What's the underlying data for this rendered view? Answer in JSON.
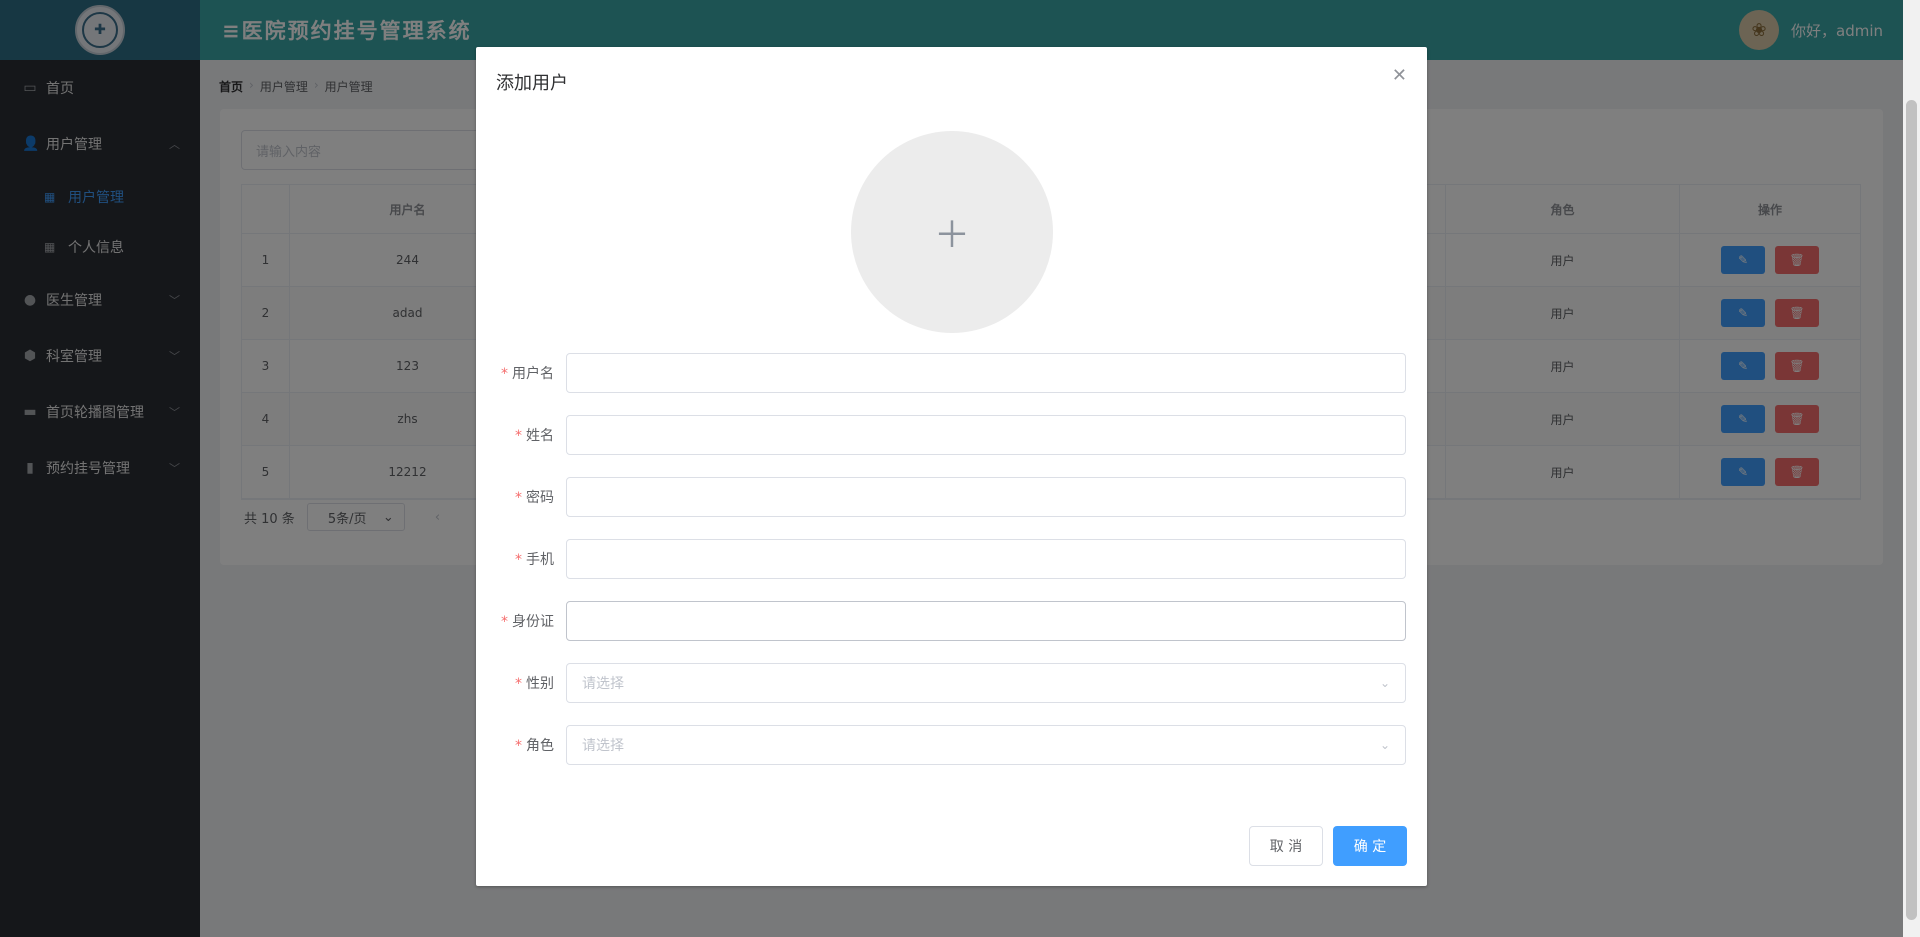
{
  "header": {
    "title": "≡医院预约挂号管理系统",
    "greeting": "你好，admin",
    "avatar_icon": "avatar-icon"
  },
  "sidebar": {
    "items": [
      {
        "label": "首页",
        "icon": "monitor-icon"
      },
      {
        "label": "用户管理",
        "icon": "users-icon",
        "expanded": true,
        "children": [
          {
            "label": "用户管理",
            "icon": "grid-icon",
            "active": true
          },
          {
            "label": "个人信息",
            "icon": "grid-icon"
          }
        ]
      },
      {
        "label": "医生管理",
        "icon": "user-icon"
      },
      {
        "label": "科室管理",
        "icon": "box-icon"
      },
      {
        "label": "首页轮播图管理",
        "icon": "picture-icon"
      },
      {
        "label": "预约挂号管理",
        "icon": "clipboard-icon"
      }
    ]
  },
  "breadcrumb": [
    "首页",
    "用户管理",
    "用户管理"
  ],
  "search": {
    "placeholder": "请输入内容"
  },
  "table": {
    "headers": {
      "username": "用户名",
      "role": "角色",
      "ops": "操作"
    },
    "rows": [
      {
        "idx": "1",
        "username": "244",
        "role": "用户"
      },
      {
        "idx": "2",
        "username": "adad",
        "role": "用户"
      },
      {
        "idx": "3",
        "username": "123",
        "role": "用户"
      },
      {
        "idx": "4",
        "username": "zhs",
        "role": "用户"
      },
      {
        "idx": "5",
        "username": "12212",
        "role": "用户"
      }
    ]
  },
  "pager": {
    "total": "共 10 条",
    "page_size": "5条/页"
  },
  "dialog": {
    "title": "添加用户",
    "fields": [
      {
        "label": "用户名",
        "value": ""
      },
      {
        "label": "姓名",
        "value": ""
      },
      {
        "label": "密码",
        "value": ""
      },
      {
        "label": "手机",
        "value": ""
      },
      {
        "label": "身份证",
        "value": ""
      },
      {
        "label": "性别",
        "placeholder": "请选择"
      },
      {
        "label": "角色",
        "placeholder": "请选择"
      }
    ],
    "cancel_label": "取 消",
    "confirm_label": "确 定"
  },
  "colors": {
    "header": "#3ba6a7",
    "sidebar": "#2b2e35",
    "primary": "#409eff",
    "danger": "#f56c6c"
  }
}
